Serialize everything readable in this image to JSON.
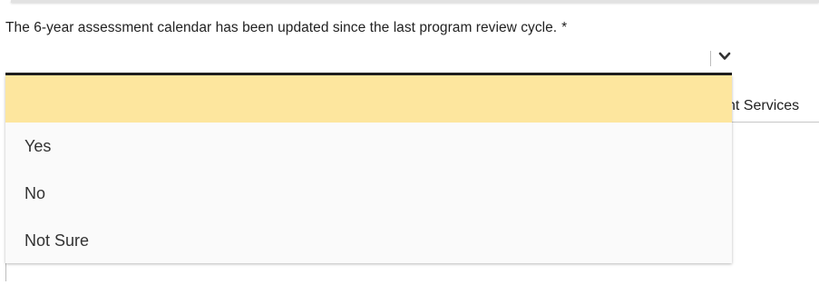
{
  "question": {
    "text": "The 6-year assessment calendar has been updated since the last program review cycle.",
    "required_marker": "*"
  },
  "select": {
    "selected_value": "",
    "toggle_icon": "chevron-down-icon"
  },
  "dropdown": {
    "highlight_color": "#fde69e",
    "options": [
      {
        "label": ""
      },
      {
        "label": "Yes"
      },
      {
        "label": "No"
      },
      {
        "label": "Not Sure"
      }
    ]
  },
  "background": {
    "partial_text": "nt Services"
  }
}
